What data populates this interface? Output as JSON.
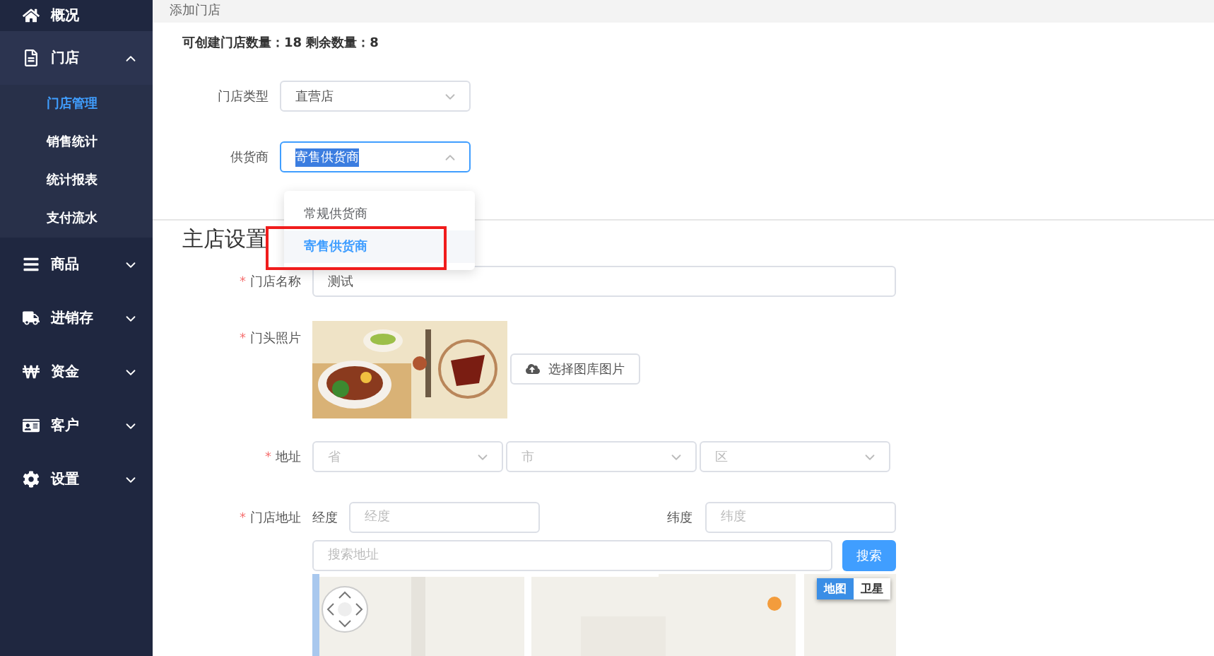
{
  "sidebar": {
    "items": [
      {
        "kind": "link",
        "label": "概况"
      },
      {
        "kind": "group",
        "label": "门店",
        "expanded": true,
        "children": [
          {
            "label": "门店管理",
            "selected": true
          },
          {
            "label": "销售统计",
            "selected": false
          },
          {
            "label": "统计报表",
            "selected": false
          },
          {
            "label": "支付流水",
            "selected": false
          }
        ]
      },
      {
        "kind": "group",
        "label": "商品",
        "expanded": false
      },
      {
        "kind": "group",
        "label": "进销存",
        "expanded": false
      },
      {
        "kind": "group",
        "label": "资金",
        "expanded": false
      },
      {
        "kind": "group",
        "label": "客户",
        "expanded": false
      },
      {
        "kind": "group",
        "label": "设置",
        "expanded": false
      }
    ]
  },
  "breadcrumb": "添加门店",
  "quota": "可创建门店数量：18 剩余数量：8",
  "store_type": {
    "label": "门店类型",
    "value": "直营店"
  },
  "supplier": {
    "label": "供货商",
    "value": "寄售供货商",
    "open": true,
    "options": [
      {
        "label": "常规供货商",
        "selected": false
      },
      {
        "label": "寄售供货商",
        "selected": true
      }
    ]
  },
  "annotation_box": true,
  "section_title": "主店设置",
  "store_name": {
    "label": "门店名称",
    "required_mark": "*",
    "value": "测试"
  },
  "store_photo": {
    "label": "门头照片",
    "required_mark": "*",
    "button": "选择图库图片"
  },
  "address": {
    "label": "地址",
    "required_mark": "*",
    "selects": [
      {
        "placeholder": "省"
      },
      {
        "placeholder": "市"
      },
      {
        "placeholder": "区"
      }
    ]
  },
  "location": {
    "label": "门店地址",
    "required_mark": "*",
    "longitude": {
      "label": "经度",
      "placeholder": "经度"
    },
    "latitude": {
      "label": "纬度",
      "placeholder": "纬度"
    },
    "search": {
      "placeholder": "搜索地址",
      "button": "搜索"
    },
    "map": {
      "kind": "picture",
      "types": [
        {
          "label": "地图",
          "selected": true
        },
        {
          "label": "卫星",
          "selected": false
        }
      ]
    }
  }
}
